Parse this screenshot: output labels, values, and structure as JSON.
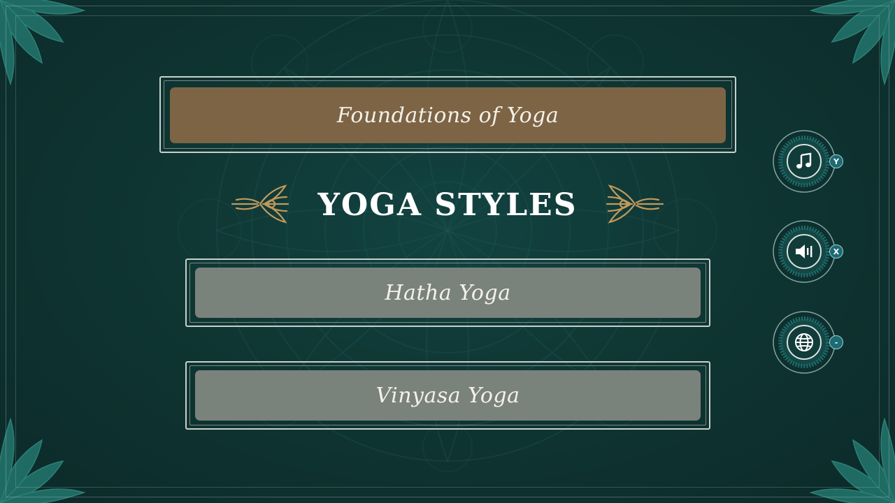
{
  "menu": {
    "category_button": "Foundations of Yoga",
    "section_title": "YOGA STYLES",
    "options": [
      {
        "label": "Hatha Yoga"
      },
      {
        "label": "Vinyasa Yoga"
      }
    ]
  },
  "side_controls": {
    "music": {
      "icon": "music-note-icon",
      "hint": "Y"
    },
    "volume": {
      "icon": "speaker-icon",
      "hint": "X"
    },
    "language": {
      "icon": "globe-icon",
      "hint": "-"
    }
  },
  "colors": {
    "background": "#0f3633",
    "category_button": "#7d6445",
    "option_button": "#7a827c",
    "ornament_gold": "#c29a5d",
    "hint_badge": "#1d6a73"
  }
}
